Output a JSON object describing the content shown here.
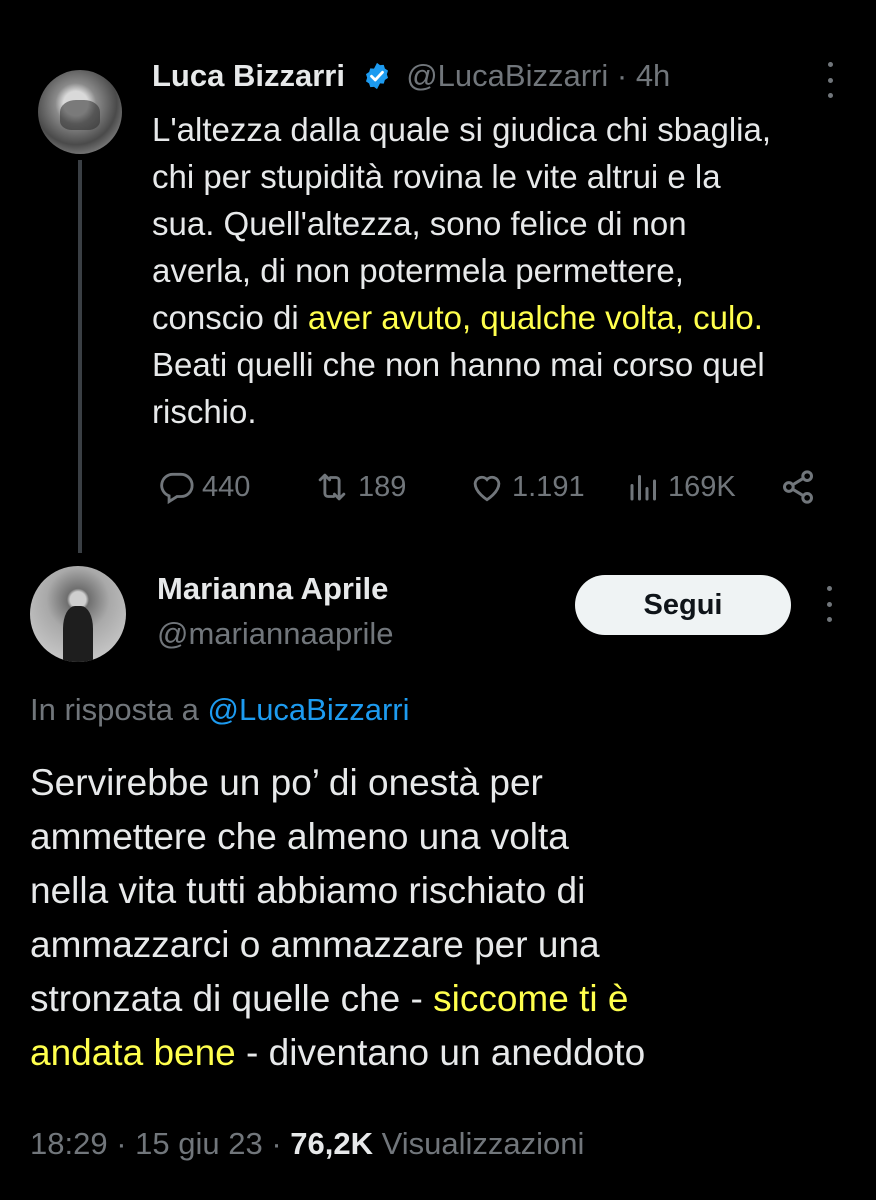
{
  "original_tweet": {
    "author_name": "Luca Bizzarri",
    "handle": "@LucaBizzarri",
    "separator": "·",
    "time": "4h",
    "text_lines": [
      "L'altezza dalla quale si giudica chi sbaglia,",
      "chi per stupidità rovina le vite altrui e la",
      "sua. Quell'altezza, sono felice di non",
      "averla, di non potermela permettere,"
    ],
    "line5_prefix": "conscio di ",
    "line5_highlight": "aver avuto, qualche volta, culo.",
    "text_lines_end": [
      "Beati quelli che non hanno mai corso quel",
      "rischio."
    ],
    "actions": {
      "replies": "440",
      "retweets": "189",
      "likes": "1.191",
      "views": "169K"
    },
    "highlight_color": "#ffff4d"
  },
  "reply": {
    "author_name": "Marianna Aprile",
    "handle": "@mariannaaprile",
    "follow_label": "Segui",
    "reply_to_prefix": "In risposta a ",
    "reply_to_handle": "@LucaBizzarri",
    "text_lines": [
      "Servirebbe un po’ di onestà per",
      "ammettere che almeno una volta",
      "nella vita tutti abbiamo rischiato di",
      "ammazzarci o ammazzare per una"
    ],
    "line5_prefix": "stronzata di quelle che - ",
    "line5_highlight": "siccome ti è",
    "line6_highlight": "andata bene",
    "line6_suffix": " - diventano un aneddoto",
    "time": "18:29",
    "separator": "·",
    "date": "15 giu 23",
    "views_count": "76,2K",
    "views_label": "Visualizzazioni"
  },
  "colors": {
    "background": "#000000",
    "text": "#e7e9ea",
    "secondary": "#71767b",
    "link": "#1d9bf0",
    "verified": "#1d9bf0"
  }
}
